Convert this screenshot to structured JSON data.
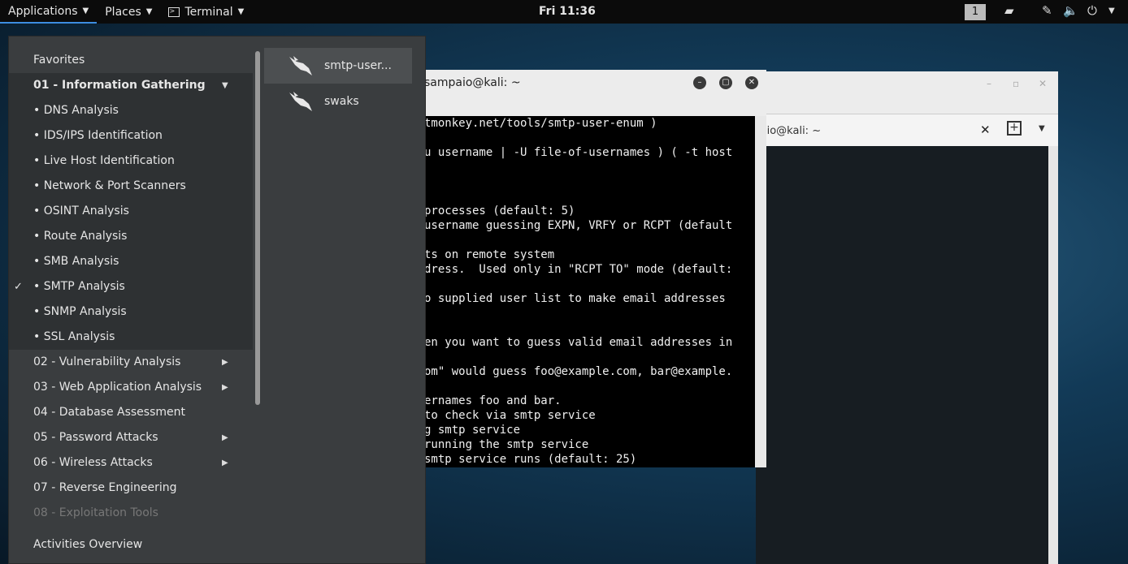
{
  "topbar": {
    "applications_label": "Applications",
    "places_label": "Places",
    "terminal_label": "Terminal",
    "clock": "Fri 11:36",
    "workspace": "1"
  },
  "bg_window": {
    "tab_title": "sampaio@kali: ~"
  },
  "terminal": {
    "title": "sampaio@kali: ~",
    "lines": [
      "tmonkey.net/tools/smtp-user-enum )",
      "",
      "u username | -U file-of-usernames ) ( -t host",
      "",
      "",
      "",
      "processes (default: 5)",
      "username guessing EXPN, VRFY or RCPT (default",
      "",
      "ts on remote system",
      "dress.  Used only in \"RCPT TO\" mode (default:",
      "",
      "o supplied user list to make email addresses",
      "",
      "",
      "en you want to guess valid email addresses in",
      "",
      "om\" would guess foo@example.com, bar@example.",
      "",
      "ernames foo and bar.",
      "to check via smtp service",
      "g smtp service",
      "running the smtp service",
      "smtp service runs (default: 25)"
    ]
  },
  "menu": {
    "categories": [
      {
        "label": "Favorites"
      },
      {
        "label": "01 - Information Gathering"
      },
      {
        "label": "• DNS Analysis"
      },
      {
        "label": "• IDS/IPS Identification"
      },
      {
        "label": "• Live Host Identification"
      },
      {
        "label": "• Network & Port Scanners"
      },
      {
        "label": "• OSINT Analysis"
      },
      {
        "label": "• Route Analysis"
      },
      {
        "label": "• SMB Analysis"
      },
      {
        "label": "• SMTP Analysis"
      },
      {
        "label": "• SNMP Analysis"
      },
      {
        "label": "• SSL Analysis"
      },
      {
        "label": "02 - Vulnerability Analysis"
      },
      {
        "label": "03 - Web Application Analysis"
      },
      {
        "label": "04 - Database Assessment"
      },
      {
        "label": "05 - Password Attacks"
      },
      {
        "label": "06 - Wireless Attacks"
      },
      {
        "label": "07 - Reverse Engineering"
      },
      {
        "label": "08 - Exploitation Tools"
      }
    ],
    "activities": "Activities Overview",
    "apps": [
      {
        "label": "smtp-user..."
      },
      {
        "label": "swaks"
      }
    ],
    "checkmark": "✓"
  }
}
